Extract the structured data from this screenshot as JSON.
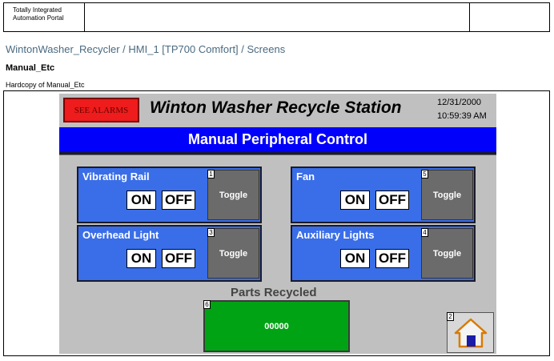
{
  "header": {
    "portal_line1": "Totally Integrated",
    "portal_line2": "Automation Portal"
  },
  "path": "WintonWasher_Recycler / HMI_1 [TP700 Comfort] / Screens",
  "screen_name": "Manual_Etc",
  "hardcopy_label": "Hardcopy of Manual_Etc",
  "hmi": {
    "alarm_button": "SEE ALARMS",
    "station_title": "Winton Washer Recycle Station",
    "date": "12/31/2000",
    "time": "10:59:39 AM",
    "banner": "Manual Peripheral Control",
    "panels": [
      {
        "name": "Vibrating Rail",
        "on": "ON",
        "off": "OFF",
        "toggle": "Toggle",
        "index": "1"
      },
      {
        "name": "Fan",
        "on": "ON",
        "off": "OFF",
        "toggle": "Toggle",
        "index": "5"
      },
      {
        "name": "Overhead Light",
        "on": "ON",
        "off": "OFF",
        "toggle": "Toggle",
        "index": "3"
      },
      {
        "name": "Auxiliary Lights",
        "on": "ON",
        "off": "OFF",
        "toggle": "Toggle",
        "index": "4"
      }
    ],
    "parts_label": "Parts Recycled",
    "parts_count": "00000",
    "parts_index": "6",
    "home_index": "2",
    "home_icon": "home-icon"
  },
  "colors": {
    "alarm_red": "#ee1c1c",
    "banner_blue": "#0000fb",
    "panel_blue": "#3a6ee8",
    "counter_green": "#00a313",
    "toggle_gray": "#6b6b6b",
    "screen_gray": "#c0c0c0"
  }
}
